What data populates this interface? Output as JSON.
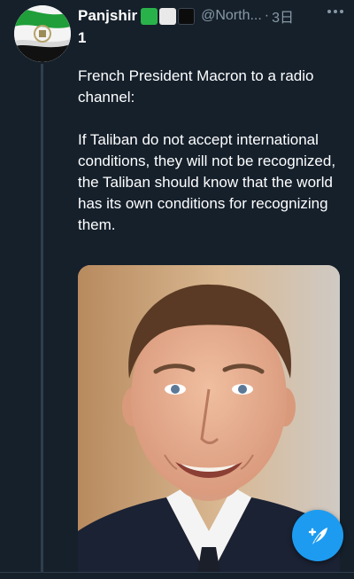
{
  "tweet": {
    "display_name": "Panjshir",
    "display_name_line2": "1",
    "flag_emoji_colors": [
      "#2ab24a",
      "#e9e9e9",
      "#0c0c0c"
    ],
    "handle": "@North...",
    "separator": "·",
    "timestamp": "3日",
    "more_icon": "ellipsis-horizontal-icon",
    "paragraphs": [
      "French President Macron to a radio channel:",
      "If Taliban do not accept international conditions, they will not be recognized, the Taliban should know that the world has its own conditions for recognizing them."
    ],
    "media_icon": "portrait-photo"
  },
  "compose_button": {
    "icon": "compose-feather-plus-icon",
    "color": "#1d9bf0"
  },
  "colors": {
    "background": "#15202b",
    "secondary_text": "#8899a6",
    "thread_line": "#2f3e4e"
  }
}
